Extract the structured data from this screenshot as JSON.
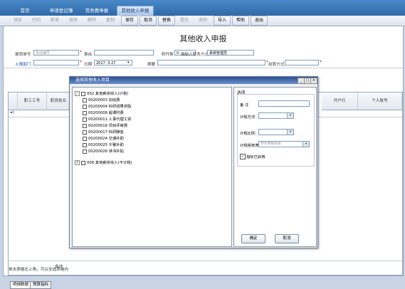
{
  "top_tabs": [
    "首页",
    "申请登记簿",
    "劳务费申报",
    "其他收入申报"
  ],
  "toolbar": [
    {
      "label": "预览",
      "enabled": false
    },
    {
      "label": "打印",
      "enabled": false
    },
    {
      "label": "新单",
      "enabled": false
    },
    {
      "label": "修改",
      "enabled": false
    },
    {
      "label": "删除",
      "enabled": false
    },
    {
      "label": "复制",
      "enabled": false
    },
    {
      "label": "保存",
      "enabled": true
    },
    {
      "label": "取消",
      "enabled": true
    },
    {
      "label": "替换",
      "enabled": true
    },
    {
      "label": "提交",
      "enabled": false
    },
    {
      "label": "收回",
      "enabled": false
    },
    {
      "label": "导入",
      "enabled": true
    },
    {
      "label": "帮助",
      "enabled": true
    },
    {
      "label": "退出",
      "enabled": true
    }
  ],
  "form": {
    "title": "其他收入申报",
    "doc_no_label": "报销单号",
    "doc_no_placeholder": "自动编号",
    "matter_label": "事由",
    "attach_label": "附件数",
    "attach_value": "0",
    "editor_label": "编制人联系方式",
    "editor_value": "系统管理员",
    "dept_label": "上报部门",
    "date_label": "日期",
    "date_value": "2017- 3-27",
    "summary_label": "摘要",
    "settle_label": "结算方式"
  },
  "grid": {
    "headers": [
      "职工工号",
      "职员姓名",
      "开户行",
      "个人账号"
    ],
    "total_label": "合计"
  },
  "status_text": "单击表格左上角，可以全选表格内",
  "bottom_tabs": [
    "明细数据",
    "预算指标"
  ],
  "dialog": {
    "title": "选择其他收入项目",
    "buttons": [
      "_",
      "□",
      "×"
    ],
    "tree": [
      {
        "label": "002 其他薪资收入(计税)",
        "level": 0,
        "expanded": true
      },
      {
        "label": "00200003 加班费",
        "level": 1
      },
      {
        "label": "00200004 科研成果奖励",
        "level": 1
      },
      {
        "label": "00200008 超课时费",
        "level": 1
      },
      {
        "label": "00200011 人事代理工资",
        "level": 1
      },
      {
        "label": "00200016 项目评审费",
        "level": 1
      },
      {
        "label": "00200017 科研酬金",
        "level": 1
      },
      {
        "label": "00200024 交通补助",
        "level": 1
      },
      {
        "label": "00200025 午餐补助",
        "level": 1
      },
      {
        "label": "00200026 读书补贴",
        "level": 1
      },
      {
        "label": "006 其他薪资收入(不计税)",
        "level": 0,
        "expanded": false
      }
    ],
    "options": {
      "group_label": "选项",
      "remark_label": "备    注",
      "tax_method_label": "计税方法：",
      "tax_ratio_label": "计税比例：",
      "tax_table_label": "计税税率表：",
      "tax_table_placeholder": "劳务费税率表",
      "flag_label": "指标已启用",
      "flag_checked": true
    },
    "ok_label": "确定",
    "cancel_label": "取消"
  }
}
